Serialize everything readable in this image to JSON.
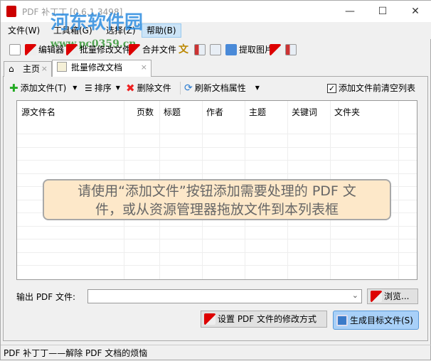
{
  "window": {
    "title": "PDF 补丁丁 [0.6.1.3498]",
    "minimize": "—",
    "maximize": "☐",
    "close": "✕"
  },
  "watermark": {
    "name": "河东软件园",
    "url": "www.pc0359.cn"
  },
  "menu": [
    "文件(W)",
    "工具箱(G)",
    "选择(Z)",
    "帮助(B)"
  ],
  "toolbar": {
    "editor": "编辑器",
    "batch": "批量修改文件",
    "merge": "合并文件",
    "extract": "提取图片"
  },
  "tabs": [
    {
      "label": "主页",
      "close": "×"
    },
    {
      "label": "批量修改文档",
      "close": "×"
    }
  ],
  "subtoolbar": {
    "add": "添加文件(T)",
    "sort": "排序",
    "remove": "删除文件",
    "refresh": "刷新文档属性",
    "clear_before_add": "添加文件前清空列表",
    "clear_checked": true
  },
  "list": {
    "columns": [
      "源文件名",
      "页数",
      "标题",
      "作者",
      "主题",
      "关键词",
      "文件夹"
    ],
    "hint_line1": "请使用“添加文件”按钮添加需要处理的 PDF 文",
    "hint_line2": "件，或从资源管理器拖放文件到本列表框"
  },
  "output": {
    "label": "输出 PDF 文件:",
    "value": "",
    "browse": "浏览..."
  },
  "buttons": {
    "settings": "设置 PDF 文件的修改方式",
    "generate": "生成目标文件(S)"
  },
  "status": "PDF 补丁丁——解除 PDF 文档的烦恼"
}
